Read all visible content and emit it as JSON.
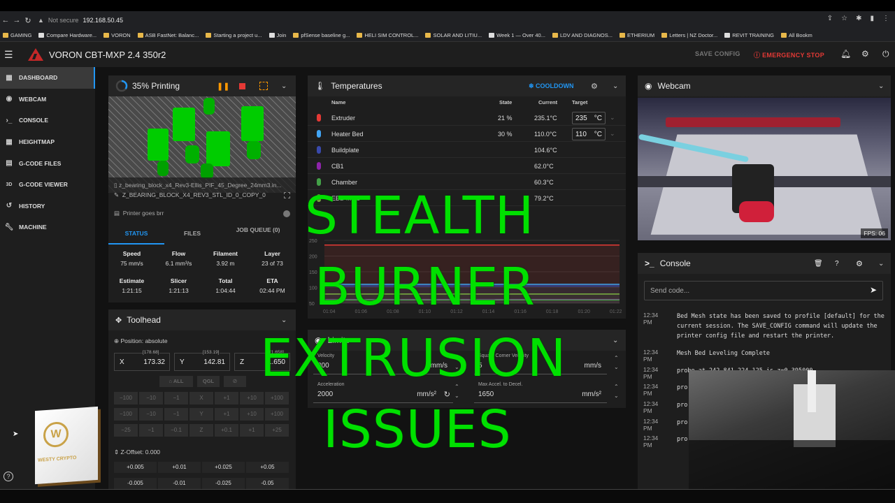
{
  "browser": {
    "security": "Not secure",
    "url": "192.168.50.45",
    "bookmarks": [
      "GAMING",
      "Compare Hardware...",
      "VORON",
      "ASB FastNet: Balanc...",
      "Starting a project u...",
      "Join",
      "pfSense baseline g...",
      "HELI SIM CONTROL...",
      "SOLAR AND LITIU...",
      "Week 1 — Over 40...",
      "LDV AND DIAGNOS...",
      "ETHERIUM",
      "Letters | NZ Doctor...",
      "REVIT TRAINING",
      "All Bookm"
    ]
  },
  "app": {
    "title": "VORON CBT-MXP 2.4 350r2",
    "save_config": "SAVE CONFIG",
    "emergency_stop": "EMERGENCY STOP"
  },
  "sidebar": {
    "items": [
      {
        "label": "DASHBOARD",
        "icon": "dashboard-icon"
      },
      {
        "label": "WEBCAM",
        "icon": "webcam-icon"
      },
      {
        "label": "CONSOLE",
        "icon": "console-icon"
      },
      {
        "label": "HEIGHTMAP",
        "icon": "heightmap-icon"
      },
      {
        "label": "G-CODE FILES",
        "icon": "file-icon"
      },
      {
        "label": "G-CODE VIEWER",
        "icon": "3d-icon"
      },
      {
        "label": "HISTORY",
        "icon": "history-icon"
      },
      {
        "label": "MACHINE",
        "icon": "wrench-icon"
      }
    ]
  },
  "status": {
    "title": "35% Printing",
    "progress": 0.35,
    "filename": "z_bearing_block_x4_Rev3-Ellis_PIF_45_Degree_24mm3.in...",
    "object": "Z_BEARING_BLOCK_X4_REV3_STL_ID_0_COPY_0",
    "message": "Printer goes brr",
    "tabs": [
      "STATUS",
      "FILES",
      "JOB QUEUE (0)"
    ],
    "row1": [
      {
        "label": "Speed",
        "value": "75 mm/s"
      },
      {
        "label": "Flow",
        "value": "6.1 mm³/s"
      },
      {
        "label": "Filament",
        "value": "3.92 m"
      },
      {
        "label": "Layer",
        "value": "23 of 73"
      }
    ],
    "row2": [
      {
        "label": "Estimate",
        "value": "1:21:15"
      },
      {
        "label": "Slicer",
        "value": "1:21:13"
      },
      {
        "label": "Total",
        "value": "1:04:44"
      },
      {
        "label": "ETA",
        "value": "02:44 PM"
      }
    ]
  },
  "toolhead": {
    "title": "Toolhead",
    "position_mode": "Position: absolute",
    "x": {
      "label": "X",
      "target": "[178.68]",
      "value": "173.32"
    },
    "y": {
      "label": "Y",
      "target": "[153.19]",
      "value": "142.81"
    },
    "z": {
      "label": "Z",
      "target": "[1.658]",
      "value": "1.650"
    },
    "home_all": "ALL",
    "qgl": "QGL",
    "jog_x": [
      "−100",
      "−10",
      "−1",
      "X",
      "+1",
      "+10",
      "+100"
    ],
    "jog_y": [
      "−100",
      "−10",
      "−1",
      "Y",
      "+1",
      "+10",
      "+100"
    ],
    "jog_z": [
      "−25",
      "−1",
      "−0.1",
      "Z",
      "+0.1",
      "+1",
      "+25"
    ],
    "z_offset": "Z-Offset: 0.000",
    "z_up": [
      "+0.005",
      "+0.01",
      "+0.025",
      "+0.05"
    ],
    "z_down": [
      "-0.005",
      "-0.01",
      "-0.025",
      "-0.05"
    ]
  },
  "temperatures": {
    "title": "Temperatures",
    "cooldown": "COOLDOWN",
    "headers": {
      "name": "Name",
      "state": "State",
      "current": "Current",
      "target": "Target"
    },
    "rows": [
      {
        "name": "Extruder",
        "state": "21 %",
        "current": "235.1°C",
        "target": "235",
        "unit": "°C",
        "color": "#e53935"
      },
      {
        "name": "Heater Bed",
        "state": "30 %",
        "current": "110.0°C",
        "target": "110",
        "unit": "°C",
        "color": "#42a5f5"
      },
      {
        "name": "Buildplate",
        "state": "",
        "current": "104.6°C",
        "target": "",
        "unit": "",
        "color": "#3949ab"
      },
      {
        "name": "CB1",
        "state": "",
        "current": "62.0°C",
        "target": "",
        "unit": "",
        "color": "#8e24aa"
      },
      {
        "name": "Chamber",
        "state": "",
        "current": "60.3°C",
        "target": "",
        "unit": "",
        "color": "#43a047"
      },
      {
        "name": "EBB-MCU",
        "state": "",
        "current": "79.2°C",
        "target": "",
        "unit": "",
        "color": "#7cb342"
      }
    ],
    "y_ticks": [
      "250",
      "200",
      "150",
      "100",
      "50"
    ],
    "x_ticks": [
      "01:04",
      "01:06",
      "01:08",
      "01:10",
      "01:12",
      "01:14",
      "01:16",
      "01:18",
      "01:20",
      "01:22"
    ]
  },
  "limits": {
    "title": "Limits",
    "velocity_label": "Velocity",
    "velocity_value": "300",
    "velocity_unit": "mm/s",
    "scv_label": "Square Corner Velocity",
    "scv_value": "5",
    "scv_unit": "mm/s",
    "accel_label": "Acceleration",
    "accel_value": "2000",
    "accel_unit": "mm/s²",
    "decel_label": "Max Accel. to Decel.",
    "decel_value": "1650",
    "decel_unit": "mm/s²"
  },
  "webcam": {
    "title": "Webcam",
    "fps": "FPS: 06"
  },
  "console": {
    "title": "Console",
    "placeholder": "Send code...",
    "lines": [
      {
        "ts": "12:34 PM",
        "msg": "Bed Mesh state has been saved to profile [default] for the current session. The SAVE_CONFIG command will update the printer config file and restart the printer."
      },
      {
        "ts": "12:34 PM",
        "msg": "Mesh Bed Leveling Complete"
      },
      {
        "ts": "12:34 PM",
        "msg": "probe at 242.841,224.125 is z=0.395000"
      },
      {
        "ts": "12:34 PM",
        "msg": "pro"
      },
      {
        "ts": "12:34 PM",
        "msg": "pro"
      },
      {
        "ts": "12:34 PM",
        "msg": "pro"
      },
      {
        "ts": "12:34 PM",
        "msg": "pro"
      },
      {
        "ts": "12:34 PM",
        "msg": "pro"
      }
    ]
  },
  "overlay": {
    "line1": "STEALTH",
    "line2": "BURNER",
    "line3": "EXTRUSION",
    "line4": "ISSUES"
  },
  "watermark": "WESTY CRYPTO"
}
